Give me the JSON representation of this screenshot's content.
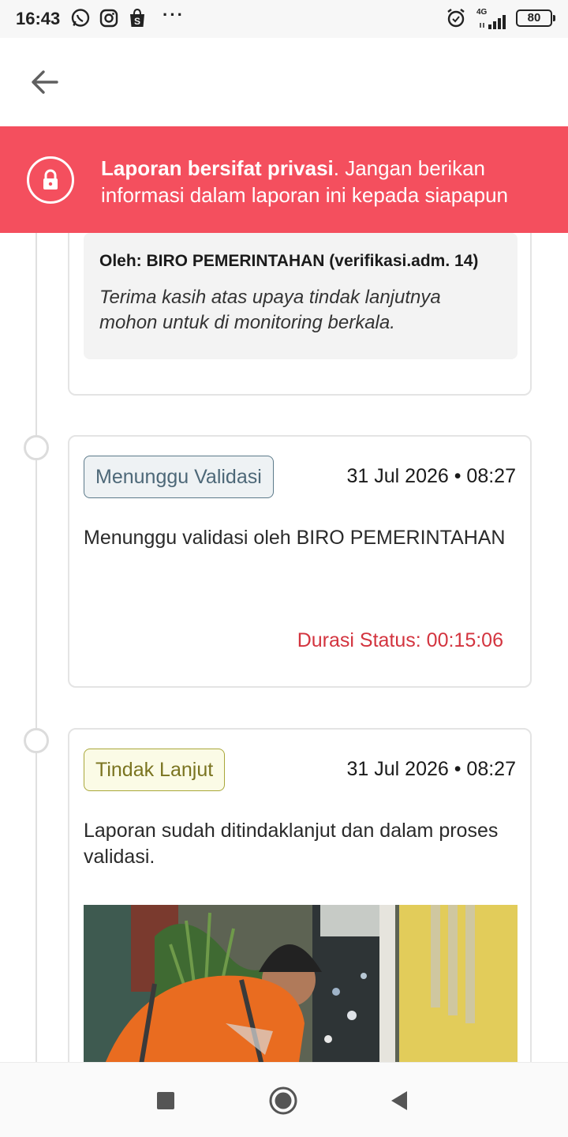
{
  "status_bar": {
    "time": "16:43",
    "network": "4G",
    "battery": "80",
    "more_indicator": "···",
    "icons": [
      "whatsapp-icon",
      "instagram-icon",
      "shopee-icon",
      "alarm-icon",
      "signal-icon",
      "battery-icon"
    ]
  },
  "app_bar": {
    "back_icon": "arrow-left-icon"
  },
  "privacy_banner": {
    "bold_text": "Laporan bersifat privasi",
    "text": ". Jangan berikan informasi dalam laporan ini kepada siapapun",
    "icon": "lock-icon",
    "color": "#f44f5e"
  },
  "timeline": {
    "items": [
      {
        "comment": {
          "author": "Oleh: BIRO PEMERINTAHAN (verifikasi.adm. 14)",
          "text": "Terima kasih atas upaya tindak lanjutnya mohon untuk di monitoring berkala."
        }
      },
      {
        "status": "Menunggu Validasi",
        "date": "31 Jul 2026 • 08:27",
        "description": "Menunggu validasi oleh BIRO PEMERINTAHAN",
        "duration": "Durasi Status: 00:15:06"
      },
      {
        "status": "Tindak Lanjut",
        "date": "31 Jul 2026 • 08:27",
        "description": "Laporan sudah ditindaklanjut dan dalam proses validasi.",
        "photo": "worker-cleaning-drain-photo"
      }
    ]
  },
  "nav_bar": {
    "buttons": [
      "recents-square-icon",
      "home-circle-icon",
      "back-triangle-icon"
    ]
  },
  "colors": {
    "duration_red": "#d3343f",
    "badge_gray_border": "#5c7a8a",
    "badge_olive_border": "#a9a73a"
  }
}
